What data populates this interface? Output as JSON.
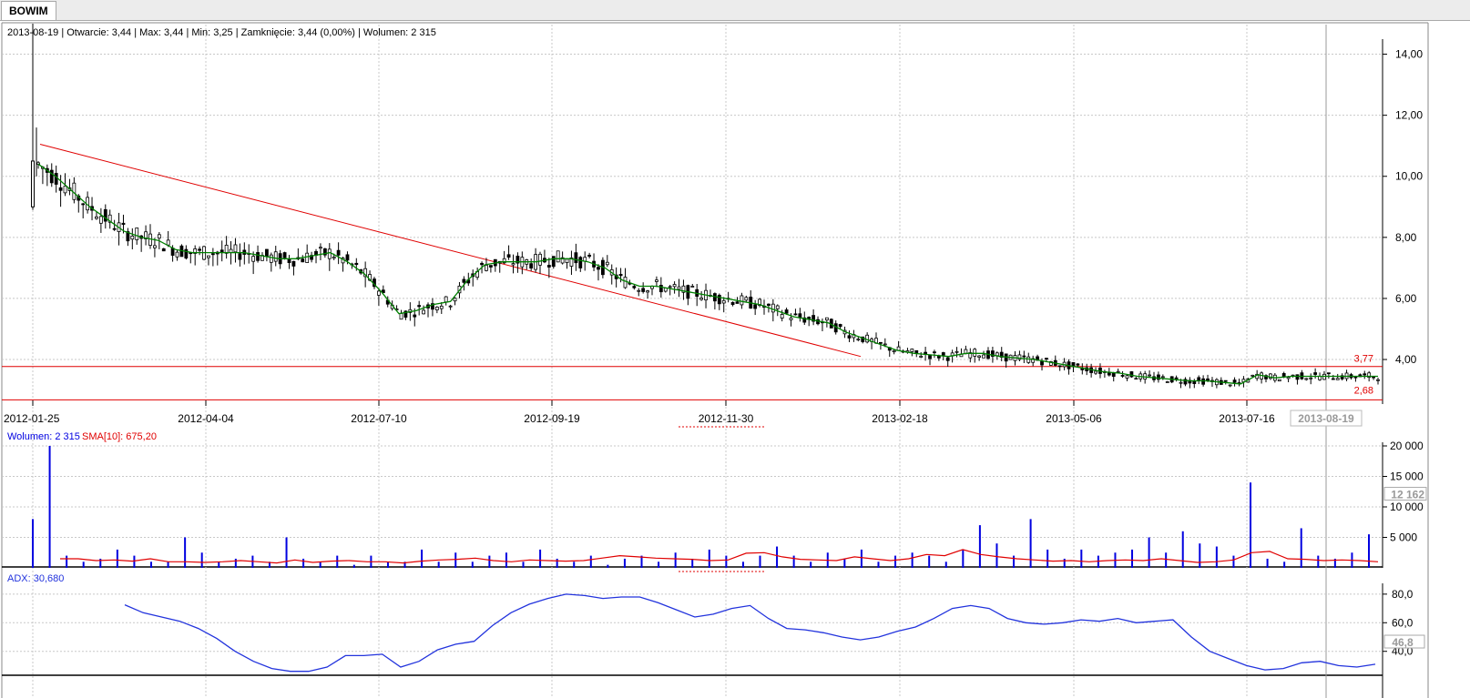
{
  "tab": {
    "label": "BOWIM"
  },
  "info_line": "2013-08-19 | Otwarcie: 3,44 | Max: 3,44 | Min: 3,25 | Zamknięcie: 3,44 (0,00%)  | Wolumen: 2 315",
  "colors": {
    "candle": "#000000",
    "sma": "#008000",
    "trendline": "#e00000",
    "volume": "#0000e0",
    "volume_sma": "#e00000",
    "adx": "#2233dd",
    "grid": "#c8c8c8"
  },
  "chart_data": [
    {
      "type": "candlestick",
      "ylim": [
        2.6,
        15.0
      ],
      "yticks": [
        4,
        6,
        8,
        10,
        12,
        14
      ],
      "ytick_labels": [
        "4,00",
        "6,00",
        "8,00",
        "10,00",
        "12,00",
        "14,00"
      ],
      "xtick_labels": [
        "2012-01-25",
        "2012-04-04",
        "2012-07-10",
        "2012-09-19",
        "2012-11-30",
        "2013-02-18",
        "2013-05-06",
        "2013-07-16"
      ],
      "cursor_date": "2013-08-19",
      "series": [
        {
          "name": "",
          "kind": "close_sma",
          "values": [
            10.4,
            10.0,
            9.5,
            9.0,
            8.6,
            8.2,
            8.0,
            7.9,
            7.6,
            7.5,
            7.5,
            7.5,
            7.5,
            7.4,
            7.3,
            7.3,
            7.4,
            7.5,
            7.2,
            6.8,
            6.2,
            5.5,
            5.6,
            5.8,
            5.9,
            6.6,
            7.1,
            7.2,
            7.2,
            7.2,
            7.3,
            7.3,
            7.2,
            7.0,
            6.6,
            6.4,
            6.4,
            6.3,
            6.2,
            6.1,
            6.0,
            5.9,
            5.8,
            5.6,
            5.4,
            5.3,
            5.2,
            4.9,
            4.7,
            4.5,
            4.3,
            4.2,
            4.15,
            4.1,
            4.2,
            4.2,
            4.1,
            4.05,
            4.0,
            3.9,
            3.8,
            3.7,
            3.6,
            3.55,
            3.45,
            3.4,
            3.35,
            3.3,
            3.3,
            3.25,
            3.2,
            3.5,
            3.4,
            3.45,
            3.45,
            3.45,
            3.45,
            3.45,
            3.45
          ]
        }
      ],
      "hlines": [
        {
          "label": "3,77",
          "value": 3.77
        },
        {
          "label": "2,68",
          "value": 2.68
        }
      ],
      "trendline": [
        {
          "date": "2012-01-25",
          "value": 11.05
        },
        {
          "date": "2012-12-28",
          "value": 4.1
        }
      ]
    },
    {
      "type": "bar",
      "legend_volume": "Wolumen: 2 315",
      "legend_sma": "SMA[10]: 675,20",
      "ylim": [
        0,
        20000
      ],
      "yticks": [
        5000,
        10000,
        15000,
        20000
      ],
      "ytick_labels": [
        "5 000",
        "10 000",
        "15 000",
        "20 000"
      ],
      "current_label": "12 162",
      "series": [
        {
          "name": "Wolumen",
          "values": [
            8000,
            20000,
            2000,
            1000,
            1500,
            3000,
            2000,
            1000,
            1000,
            5000,
            2500,
            1000,
            1500,
            2000,
            1000,
            5000,
            1500,
            1000,
            2000,
            500,
            2000,
            1000,
            1000,
            3000,
            1000,
            2500,
            1000,
            2000,
            2500,
            1000,
            3000,
            1500,
            1000,
            2000,
            500,
            1500,
            2000,
            1000,
            2500,
            1500,
            3000,
            2000,
            1000,
            2000,
            3500,
            2000,
            1000,
            2500,
            1500,
            3000,
            1000,
            2000,
            2500,
            2000,
            1000,
            3000,
            7000,
            4000,
            2000,
            8000,
            3000,
            1500,
            3000,
            2000,
            2500,
            3000,
            5000,
            2500,
            6000,
            4000,
            3500,
            2000,
            14000,
            1500,
            1000,
            6500,
            2000,
            1500,
            2500,
            5500
          ]
        },
        {
          "name": "SMA[10]",
          "values": [
            1500,
            1500,
            1200,
            1300,
            1100,
            1500,
            1000,
            1000,
            900,
            1000,
            1200,
            1000,
            800,
            1300,
            900,
            1100,
            1200,
            1000,
            1000,
            800,
            1100,
            1300,
            1400,
            1600,
            1200,
            1000,
            1300,
            1200,
            1100,
            1200,
            1600,
            2000,
            1800,
            1600,
            1500,
            1400,
            1200,
            1300,
            2400,
            2500,
            1800,
            1400,
            1300,
            1200,
            1800,
            1500,
            1200,
            1500,
            2200,
            2000,
            3000,
            2200,
            1800,
            1500,
            1300,
            1100,
            1200,
            1000,
            1200,
            1300,
            1200,
            1500,
            1200,
            900,
            1000,
            1300,
            2500,
            2700,
            1500,
            1400,
            1200,
            1300,
            1200,
            1000
          ]
        }
      ]
    },
    {
      "type": "line",
      "legend": "ADX: 30,680",
      "ylim": [
        22,
        85
      ],
      "yticks": [
        40,
        60,
        80
      ],
      "ytick_labels": [
        "40,0",
        "60,0",
        "80,0"
      ],
      "current_label": "46,8",
      "series": [
        {
          "name": "ADX",
          "values": [
            72.5,
            67,
            64,
            61,
            56,
            49,
            40,
            33,
            28,
            26,
            26,
            29,
            37,
            37,
            38,
            29,
            33,
            41,
            45,
            47,
            58,
            67,
            73,
            77,
            80,
            79,
            77,
            78,
            78,
            74,
            69,
            64,
            66,
            70,
            72,
            63,
            56,
            55,
            53,
            50,
            48,
            50,
            54,
            57,
            63,
            70,
            72,
            70,
            63,
            60,
            59,
            60,
            62,
            61,
            63,
            60,
            61,
            62,
            50,
            40,
            35,
            30,
            27,
            28,
            32,
            33,
            30,
            29,
            31
          ]
        }
      ]
    }
  ]
}
